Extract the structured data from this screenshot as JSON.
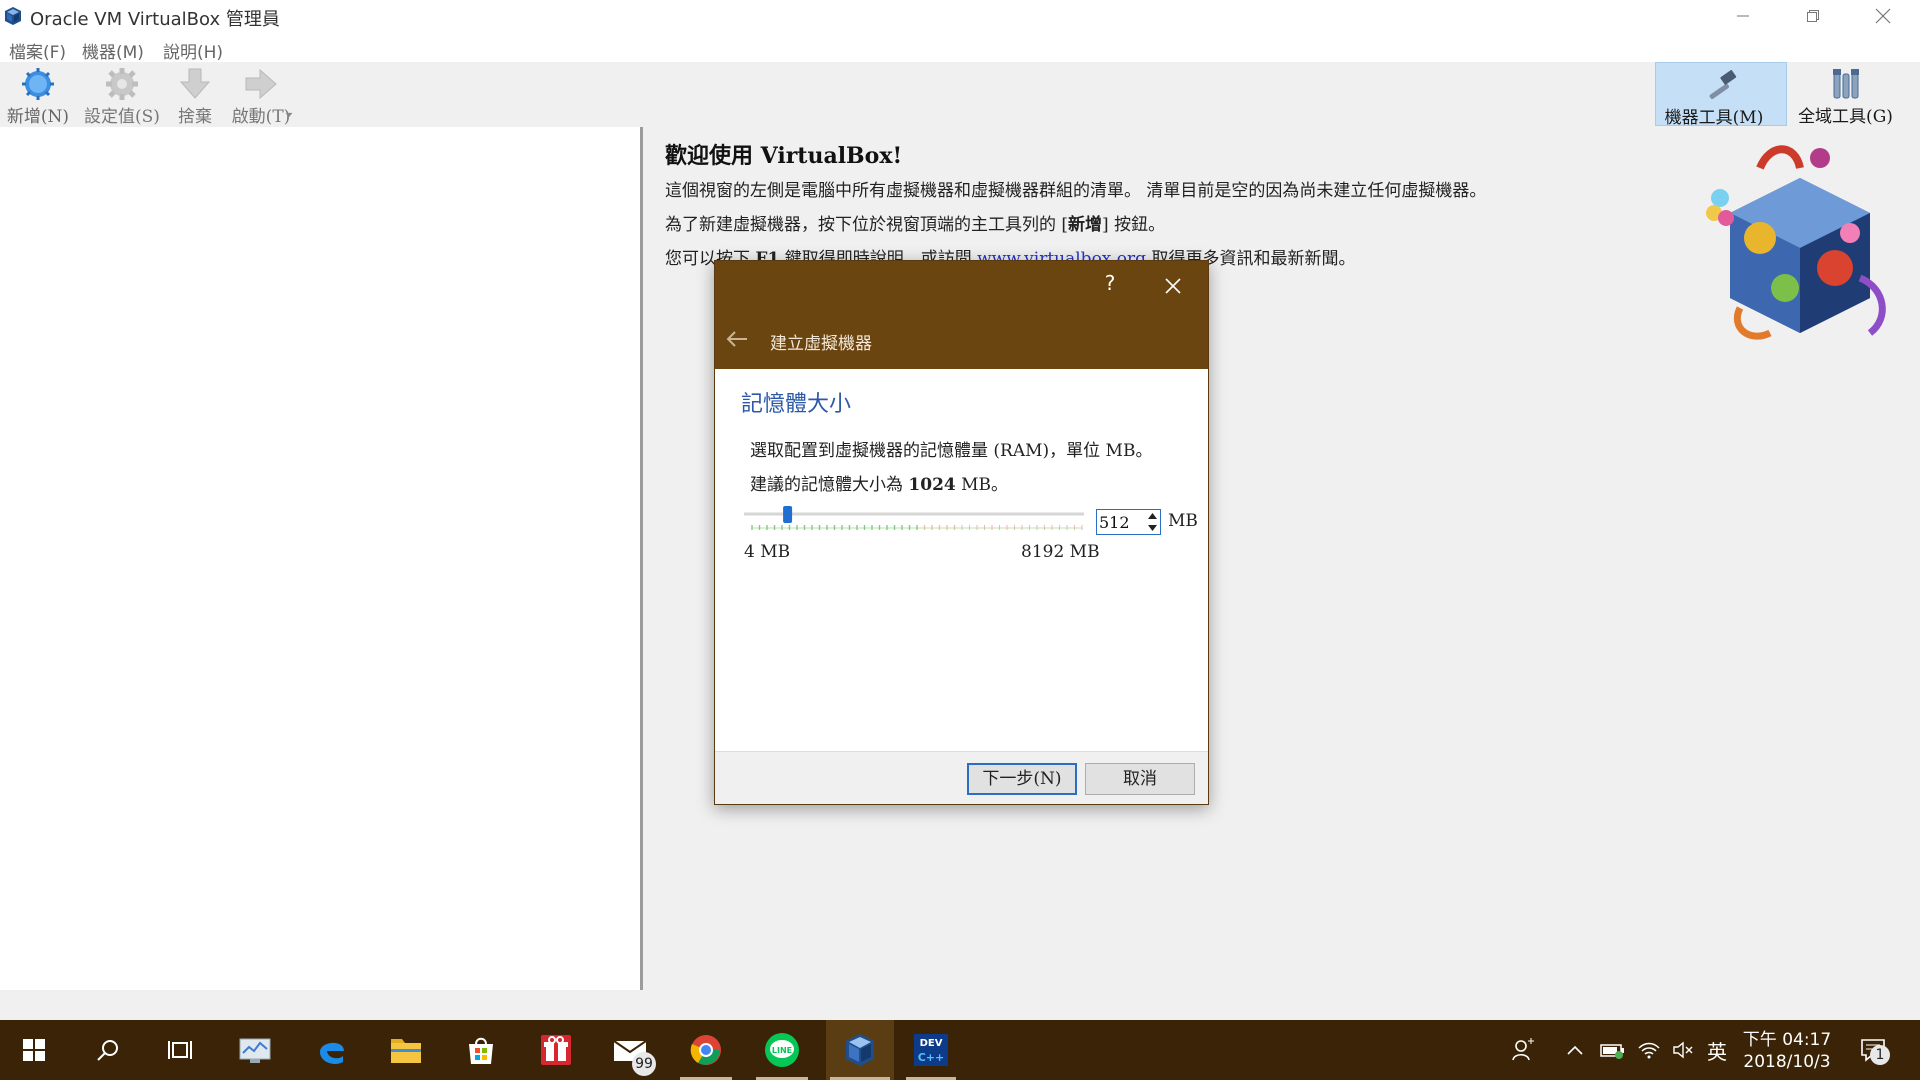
{
  "window": {
    "title": "Oracle VM VirtualBox 管理員",
    "controls": [
      "minimize-icon",
      "restore-icon",
      "close-icon"
    ]
  },
  "menubar": {
    "items": [
      "檔案(F)",
      "機器(M)",
      "說明(H)"
    ]
  },
  "toolbar": {
    "new_label": "新增(N)",
    "settings_label": "設定值(S)",
    "discard_label": "捨棄",
    "start_label": "啟動(T)",
    "machine_tools_label": "機器工具(M)",
    "global_tools_label": "全域工具(G)"
  },
  "welcome": {
    "title": "歡迎使用 VirtualBox!",
    "line1": "這個視窗的左側是電腦中所有虛擬機器和虛擬機器群組的清單。 清單目前是空的因為尚未建立任何虛擬機器。",
    "line2_prefix": "為了新建虛擬機器，按下位於視窗頂端的主工具列的 [",
    "line2_bold": "新增",
    "line2_suffix": "] 按鈕。",
    "line3_prefix": "您可以按下 ",
    "line3_key": "F1",
    "line3_mid": " 鍵取得即時說明，或訪問 ",
    "line3_link": "www.virtualbox.org",
    "line3_suffix": " 取得更多資訊和最新新聞。"
  },
  "dialog": {
    "help": "?",
    "title": "建立虛擬機器",
    "section_title": "記憶體大小",
    "description": "選取配置到虛擬機器的記憶體量 (RAM)，單位 MB。",
    "recommend_prefix": "建議的記憶體大小為 ",
    "recommend_value": "1024",
    "recommend_suffix": " MB。",
    "memory_value": "512",
    "memory_unit": "MB",
    "slider_min_label": "4 MB",
    "slider_max_label": "8192 MB",
    "slider": {
      "min": 4,
      "max": 8192,
      "value": 512,
      "recommended": 1024
    },
    "next_button": "下一步(N)",
    "cancel_button": "取消"
  },
  "taskbar": {
    "items": [
      "start-icon",
      "search-icon",
      "task-view-icon",
      "monitor-app-icon",
      "edge-icon",
      "file-explorer-icon",
      "store-icon",
      "gift-app-icon",
      "mail-icon",
      "chrome-icon",
      "line-icon",
      "virtualbox-icon",
      "devcpp-icon"
    ],
    "mail_badge": "99",
    "language": "英",
    "clock_time": "下午 04:17",
    "clock_date": "2018/10/3",
    "notification_badge": "1"
  },
  "colors": {
    "dialog_header": "#6b4510",
    "taskbar": "#3a2307",
    "accent_blue": "#2c5aa8",
    "toolbar_active": "#c5dff6"
  }
}
